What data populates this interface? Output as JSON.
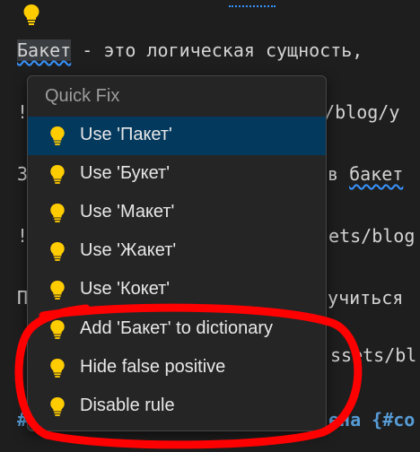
{
  "editor": {
    "line1_word": "Бакет",
    "line1_rest": " - это логическая сущность,",
    "line2_start": "!",
    "line2_end": "ts/blog/y",
    "line3_start": "З",
    "line3_mid": "в ",
    "line3_word": "бакет",
    "line4_start": "!",
    "line4_end": "sets/blog",
    "line5_start": "П",
    "line5_end": "лучиться",
    "line6_start": "!",
    "line6_end": "ssets/bl",
    "line7_start": "#",
    "line7_end": "ена {#co"
  },
  "quick_fix": {
    "title": "Quick Fix",
    "items": [
      {
        "label": "Use 'Пакет'",
        "active": true
      },
      {
        "label": "Use 'Букет'"
      },
      {
        "label": "Use 'Макет'"
      },
      {
        "label": "Use 'Жакет'"
      },
      {
        "label": "Use 'Кокет'"
      },
      {
        "label": "Add 'Бакет' to dictionary"
      },
      {
        "label": "Hide false positive"
      },
      {
        "label": "Disable rule"
      }
    ]
  },
  "colors": {
    "bulb": "#ffcc00",
    "highlight": "#04395e",
    "annotation": "#ff0000"
  }
}
